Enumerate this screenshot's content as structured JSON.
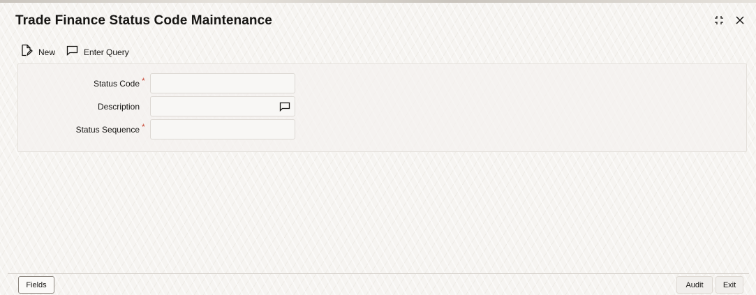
{
  "window": {
    "title": "Trade Finance Status Code Maintenance",
    "icons": [
      "collapse-icon",
      "close-icon"
    ]
  },
  "toolbar": {
    "new_label": "New",
    "new_icon": "new-document-icon",
    "query_label": "Enter Query",
    "query_icon": "message-bubble-icon"
  },
  "form": {
    "fields": [
      {
        "label": "Status Code",
        "required": "*",
        "value": ""
      },
      {
        "label": "Description",
        "required": "",
        "value": "",
        "lov_icon": "message-bubble-icon"
      },
      {
        "label": "Status Sequence",
        "required": "*",
        "value": ""
      }
    ]
  },
  "footer": {
    "fields_label": "Fields",
    "audit_label": "Audit",
    "exit_label": "Exit"
  },
  "colors": {
    "required": "#c74634",
    "background": "#f6f4f1",
    "text": "#161513"
  }
}
